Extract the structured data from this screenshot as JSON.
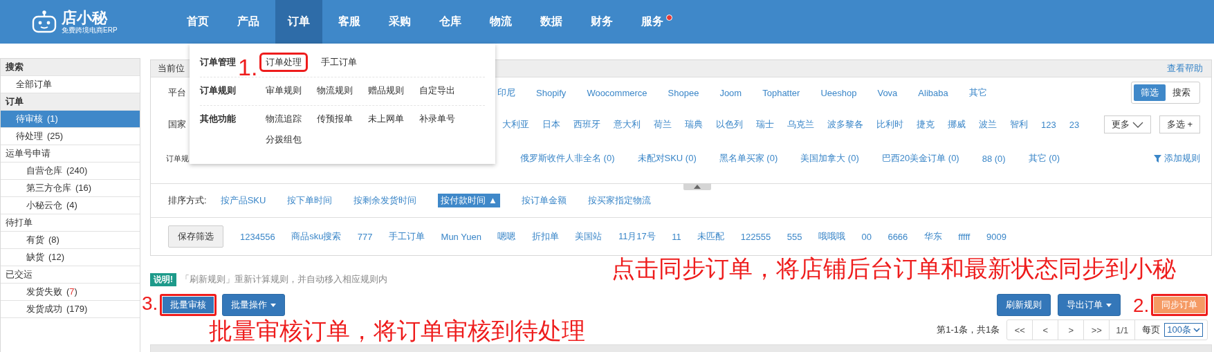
{
  "header": {
    "logo": {
      "name": "店小秘",
      "tagline": "免费跨境电商ERP"
    },
    "nav": [
      {
        "label": "首页",
        "selected": false,
        "badge": false
      },
      {
        "label": "产品",
        "selected": false,
        "badge": false
      },
      {
        "label": "订单",
        "selected": true,
        "badge": false
      },
      {
        "label": "客服",
        "selected": false,
        "badge": false
      },
      {
        "label": "采购",
        "selected": false,
        "badge": false
      },
      {
        "label": "仓库",
        "selected": false,
        "badge": false
      },
      {
        "label": "物流",
        "selected": false,
        "badge": false
      },
      {
        "label": "数据",
        "selected": false,
        "badge": false
      },
      {
        "label": "财务",
        "selected": false,
        "badge": false
      },
      {
        "label": "服务",
        "selected": false,
        "badge": true
      }
    ]
  },
  "menu": {
    "sections": [
      {
        "title": "订单管理",
        "items": [
          {
            "label": "订单处理",
            "highlighted": true
          },
          {
            "label": "手工订单",
            "highlighted": false
          }
        ]
      },
      {
        "title": "订单规则",
        "items": [
          {
            "label": "审单规则",
            "highlighted": false
          },
          {
            "label": "物流规则",
            "highlighted": false
          },
          {
            "label": "赠品规则",
            "highlighted": false
          },
          {
            "label": "自定导出",
            "highlighted": false
          }
        ]
      },
      {
        "title": "其他功能",
        "items": [
          {
            "label": "物流追踪",
            "highlighted": false
          },
          {
            "label": "传预报单",
            "highlighted": false
          },
          {
            "label": "未上网单",
            "highlighted": false
          },
          {
            "label": "补录单号",
            "highlighted": false
          },
          {
            "label": "分拨组包",
            "highlighted": false
          }
        ]
      }
    ]
  },
  "sidebar": {
    "items": [
      {
        "label": "搜索",
        "kind": "heading",
        "selected": false
      },
      {
        "label": "全部订单",
        "kind": "item",
        "selected": false
      },
      {
        "label": "订单",
        "kind": "heading",
        "selected": false
      },
      {
        "label": "待审核",
        "count": "(1)",
        "kind": "item",
        "selected": true
      },
      {
        "label": "待处理",
        "count": "(25)",
        "kind": "item",
        "selected": false
      },
      {
        "label": "运单号申请",
        "kind": "group",
        "selected": false,
        "children": [
          {
            "label": "自营仓库",
            "count": "(240)",
            "selected": false
          },
          {
            "label": "第三方仓库",
            "count": "(16)",
            "selected": false
          },
          {
            "label": "小秘云仓",
            "count": "(4)",
            "selected": false
          }
        ]
      },
      {
        "label": "待打单",
        "kind": "group",
        "selected": false,
        "children": [
          {
            "label": "有货",
            "count": "(8)",
            "selected": false
          },
          {
            "label": "缺货",
            "count": "(12)",
            "selected": false
          }
        ]
      },
      {
        "label": "已交运",
        "kind": "group",
        "selected": false,
        "children": [
          {
            "label": "发货失败",
            "count": "(7)",
            "alert": true,
            "selected": false
          },
          {
            "label": "发货成功",
            "count": "(179)",
            "selected": false
          }
        ]
      }
    ]
  },
  "panel": {
    "breadcrumb_label": "当前位",
    "help_link": "查看帮助",
    "platform_filter": {
      "label": "平台",
      "options": [
        "印尼",
        "Shopify",
        "Woocommerce",
        "Shopee",
        "Joom",
        "Tophatter",
        "Ueeshop",
        "Vova",
        "Alibaba",
        "其它"
      ],
      "view_toggle": [
        {
          "label": "筛选",
          "selected": true
        },
        {
          "label": "搜索",
          "selected": false
        }
      ]
    },
    "country_filter": {
      "label": "国家",
      "options": [
        "大利亚",
        "日本",
        "西班牙",
        "意大利",
        "荷兰",
        "瑞典",
        "以色列",
        "瑞士",
        "乌克兰",
        "波多黎各",
        "比利时",
        "捷克",
        "挪威",
        "波兰",
        "智利",
        "123",
        "23"
      ],
      "more_button": "更多",
      "multi_button": "多选 +"
    },
    "rule_filter": {
      "label": "订单规",
      "options": [
        {
          "label": "俄罗斯收件人非全名",
          "count": "(0)"
        },
        {
          "label": "未配对SKU",
          "count": "(0)"
        },
        {
          "label": "黑名单买家",
          "count": "(0)"
        },
        {
          "label": "美国加拿大",
          "count": "(0)"
        },
        {
          "label": "巴西20美金订单",
          "count": "(0)"
        },
        {
          "label": "88",
          "count": "(0)"
        },
        {
          "label": "其它",
          "count": "(0)"
        }
      ],
      "add_rule": "添加规则"
    },
    "sort": {
      "label": "排序方式:",
      "options": [
        {
          "label": "按产品SKU",
          "selected": false
        },
        {
          "label": "按下单时间",
          "selected": false
        },
        {
          "label": "按剩余发货时间",
          "selected": false
        },
        {
          "label": "按付款时间",
          "selected": true,
          "arrow": "▲"
        },
        {
          "label": "按订单金额",
          "selected": false
        },
        {
          "label": "按买家指定物流",
          "selected": false
        }
      ]
    },
    "saved_filters": {
      "save_button": "保存筛选",
      "items": [
        "1234556",
        "商品sku搜索",
        "777",
        "手工订单",
        "Mun Yuen",
        "嗯嗯",
        "折扣单",
        "美国站",
        "11月17号",
        "11",
        "未匹配",
        "122555",
        "555",
        "哦哦哦",
        "00",
        "6666",
        "华东",
        "fffff",
        "9009"
      ]
    }
  },
  "notice": {
    "tag": "说明!",
    "text": "「刷新规则」重新计算规则，并自动移入相应规则内"
  },
  "actions": {
    "left": [
      {
        "label": "批量审核",
        "kind": "blue",
        "caret": false,
        "highlighted": true
      },
      {
        "label": "批量操作",
        "kind": "blue",
        "caret": true,
        "highlighted": false
      }
    ],
    "right": [
      {
        "label": "刷新规则",
        "kind": "blue",
        "caret": false,
        "highlighted": false
      },
      {
        "label": "导出订单",
        "kind": "blue",
        "caret": true,
        "highlighted": false
      },
      {
        "label": "同步订单",
        "kind": "orange",
        "caret": false,
        "highlighted": true
      }
    ]
  },
  "pagination": {
    "summary": "第1-1条，共1条",
    "buttons": [
      "<<",
      "<",
      ">",
      ">>",
      "1/1"
    ],
    "per_page_label": "每页",
    "per_page": "100条"
  },
  "annotations": [
    {
      "kind": "step",
      "text": "1."
    },
    {
      "kind": "step",
      "text": "2."
    },
    {
      "kind": "step",
      "text": "3."
    },
    {
      "kind": "note",
      "text": "点击同步订单，将店铺后台订单和最新状态同步到小秘"
    },
    {
      "kind": "note",
      "text": "批量审核订单，将订单审核到待处理"
    }
  ]
}
